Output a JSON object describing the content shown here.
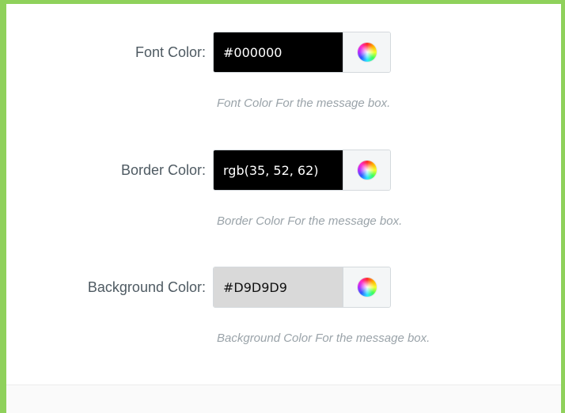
{
  "settings": {
    "font_color": {
      "label": "Font Color:",
      "value": "#000000",
      "swatch": "#000000",
      "text_color": "#ffffff",
      "hint": "Font Color For the message box."
    },
    "border_color": {
      "label": "Border Color:",
      "value": "rgb(35, 52, 62)",
      "swatch": "#000000",
      "text_color": "#ffffff",
      "hint": "Border Color For the message box."
    },
    "background_color": {
      "label": "Background Color:",
      "value": "#D9D9D9",
      "swatch": "#D9D9D9",
      "text_color": "#111111",
      "hint": "Background Color For the message box."
    }
  },
  "icons": {
    "picker": "color-wheel-icon"
  },
  "theme": {
    "frame_border": "#8fd15b",
    "label_color": "#4e5a62",
    "hint_color": "#9aa3a9"
  }
}
